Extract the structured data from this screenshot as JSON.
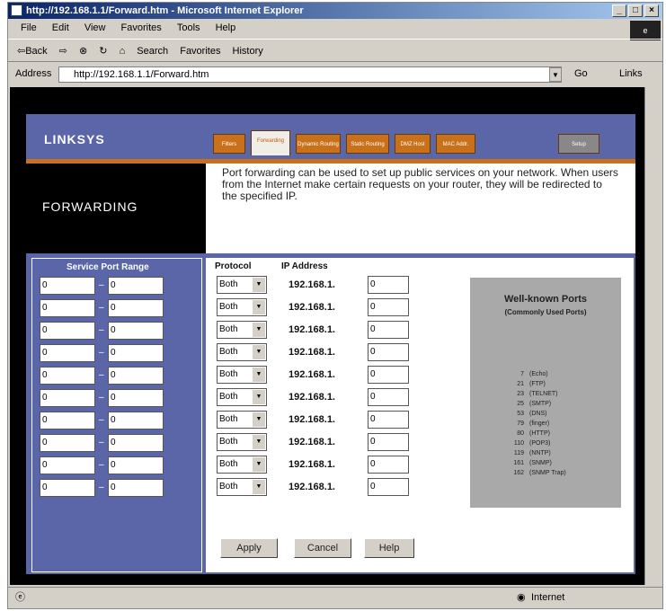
{
  "window": {
    "title": "http://192.168.1.1/Forward.htm - Microsoft Internet Explorer",
    "controls": [
      "_",
      "□",
      "×"
    ]
  },
  "menu": [
    "File",
    "Edit",
    "View",
    "Favorites",
    "Tools",
    "Help"
  ],
  "toolbar": {
    "back": "⇦Back",
    "forward": "⇨",
    "stop": "⊗",
    "refresh": "↻",
    "home": "⌂",
    "search": "Search",
    "favorites": "Favorites",
    "history": "History"
  },
  "address": {
    "label": "Address",
    "url": "http://192.168.1.1/Forward.htm",
    "go": "Go",
    "links": "Links"
  },
  "router": {
    "brand": "LINKSYS",
    "tabs": [
      "Filters",
      "Forwarding",
      "Dynamic Routing",
      "Static Routing",
      "DMZ Host",
      "MAC Addr. Clone",
      "Setup"
    ],
    "section_title": "FORWARDING",
    "description": "Port forwarding can be used to set up public services on your network. When users from the Internet make certain requests on your router, they will be redirected to the specified IP.",
    "headers": {
      "service_port_range": "Service Port Range",
      "protocol": "Protocol",
      "ip_address": "IP Address"
    },
    "rows": [
      {
        "start": "0",
        "end": "0",
        "protocol": "Both",
        "ip_prefix": "192.168.1.",
        "ip_last": "0"
      },
      {
        "start": "0",
        "end": "0",
        "protocol": "Both",
        "ip_prefix": "192.168.1.",
        "ip_last": "0"
      },
      {
        "start": "0",
        "end": "0",
        "protocol": "Both",
        "ip_prefix": "192.168.1.",
        "ip_last": "0"
      },
      {
        "start": "0",
        "end": "0",
        "protocol": "Both",
        "ip_prefix": "192.168.1.",
        "ip_last": "0"
      },
      {
        "start": "0",
        "end": "0",
        "protocol": "Both",
        "ip_prefix": "192.168.1.",
        "ip_last": "0"
      },
      {
        "start": "0",
        "end": "0",
        "protocol": "Both",
        "ip_prefix": "192.168.1.",
        "ip_last": "0"
      },
      {
        "start": "0",
        "end": "0",
        "protocol": "Both",
        "ip_prefix": "192.168.1.",
        "ip_last": "0"
      },
      {
        "start": "0",
        "end": "0",
        "protocol": "Both",
        "ip_prefix": "192.168.1.",
        "ip_last": "0"
      },
      {
        "start": "0",
        "end": "0",
        "protocol": "Both",
        "ip_prefix": "192.168.1.",
        "ip_last": "0"
      },
      {
        "start": "0",
        "end": "0",
        "protocol": "Both",
        "ip_prefix": "192.168.1.",
        "ip_last": "0"
      }
    ],
    "well_known": {
      "title": "Well-known Ports",
      "subtitle": "(Commonly Used Ports)",
      "ports": [
        {
          "num": "7",
          "name": "(Echo)"
        },
        {
          "num": "21",
          "name": "(FTP)"
        },
        {
          "num": "23",
          "name": "(TELNET)"
        },
        {
          "num": "25",
          "name": "(SMTP)"
        },
        {
          "num": "53",
          "name": "(DNS)"
        },
        {
          "num": "79",
          "name": "(finger)"
        },
        {
          "num": "80",
          "name": "(HTTP)"
        },
        {
          "num": "110",
          "name": "(POP3)"
        },
        {
          "num": "119",
          "name": "(NNTP)"
        },
        {
          "num": "161",
          "name": "(SNMP)"
        },
        {
          "num": "162",
          "name": "(SNMP Trap)"
        }
      ]
    },
    "buttons": {
      "apply": "Apply",
      "cancel": "Cancel",
      "help": "Help"
    }
  },
  "status": {
    "zone": "Internet"
  }
}
